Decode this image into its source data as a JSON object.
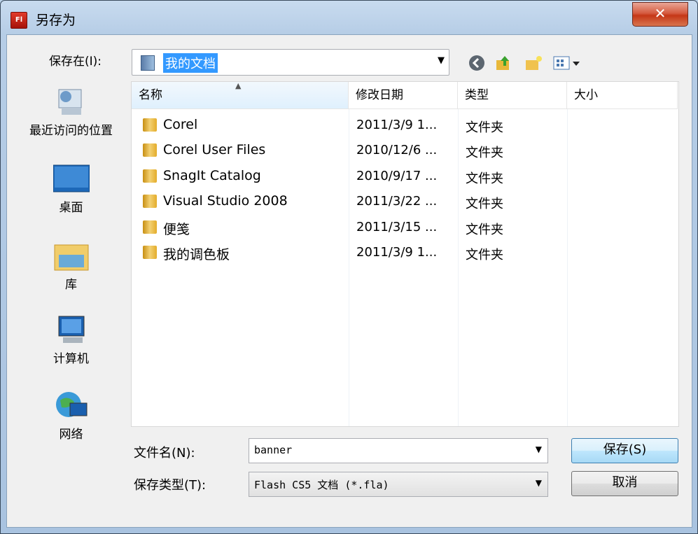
{
  "window": {
    "title": "另存为",
    "close_label": "✕"
  },
  "toolbar": {
    "look_in_label": "保存在(I):",
    "look_in_value": "我的文档"
  },
  "places": [
    {
      "label": "最近访问的位置"
    },
    {
      "label": "桌面"
    },
    {
      "label": "库"
    },
    {
      "label": "计算机"
    },
    {
      "label": "网络"
    }
  ],
  "file_list": {
    "columns": [
      "名称",
      "修改日期",
      "类型",
      "大小"
    ],
    "rows": [
      {
        "name": "Corel",
        "date": "2011/3/9 1...",
        "type": "文件夹",
        "size": ""
      },
      {
        "name": "Corel User Files",
        "date": "2010/12/6 ...",
        "type": "文件夹",
        "size": ""
      },
      {
        "name": "SnagIt Catalog",
        "date": "2010/9/17 ...",
        "type": "文件夹",
        "size": ""
      },
      {
        "name": "Visual Studio 2008",
        "date": "2011/3/22 ...",
        "type": "文件夹",
        "size": ""
      },
      {
        "name": "便笺",
        "date": "2011/3/15 ...",
        "type": "文件夹",
        "size": ""
      },
      {
        "name": "我的调色板",
        "date": "2011/3/9 1...",
        "type": "文件夹",
        "size": ""
      }
    ]
  },
  "form": {
    "filename_label": "文件名(N):",
    "filename_value": "banner",
    "filetype_label": "保存类型(T):",
    "filetype_value": "Flash CS5 文档 (*.fla)",
    "save_label": "保存(S)",
    "cancel_label": "取消"
  }
}
